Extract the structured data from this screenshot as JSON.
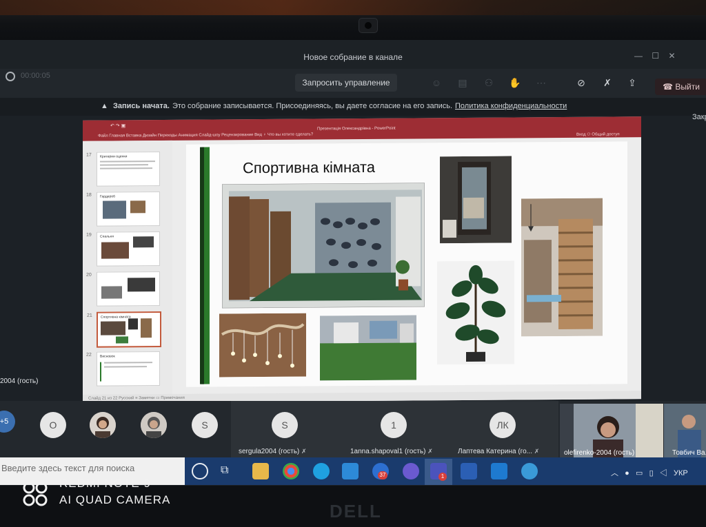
{
  "meeting": {
    "title": "Новое собрание в канале",
    "timer": "00:00:05",
    "request_control_label": "Запросить управление",
    "leave_label": "Выйти",
    "minimize": "—",
    "maximize": "☐",
    "close": "✕"
  },
  "recording_banner": {
    "title": "Запись начата.",
    "message": "Это собрание записывается. Присоединяясь, вы даете согласие на его запись.",
    "link": "Политика конфиденциальности",
    "close_label": "Закрыть"
  },
  "ppt": {
    "window_title": "Презентація Олександрівна - PowerPoint",
    "menus": "Файл   Главная   Вставка   Дизайн   Переходы   Анимация   Слайд-шоу   Рецензирование   Вид   ♀ Что вы хотите сделать?",
    "quick_access": "↶   ↷   ▣",
    "right_tools": "Вход   ⚇ Общий доступ",
    "thumbs": [
      {
        "n": "17",
        "text": "Критерии оценки"
      },
      {
        "n": "18",
        "text": "Гардероб"
      },
      {
        "n": "19",
        "text": "Спальня"
      },
      {
        "n": "20",
        "text": ""
      },
      {
        "n": "21",
        "text": "Спортивна кімната"
      },
      {
        "n": "22",
        "text": "Висновок"
      }
    ],
    "slide_title": "Спортивна кімната",
    "status": "Слайд 21 из 22   Русский   ≡ Заметки   ▭ Примечания"
  },
  "participants": {
    "more_count": "+5",
    "left_guest": "2004 (гость)",
    "avatars": [
      "O",
      "S"
    ],
    "tiles": [
      {
        "initial": "S",
        "name": "sergula2004 (гость)"
      },
      {
        "initial": "1",
        "name": "1anna.shapoval1 (гость)"
      },
      {
        "initial": "ЛК",
        "name": "Лаптева Катерина (го..."
      }
    ],
    "video1_name": "olefirenko-2004 (гость)",
    "video2_name": "Товбич Ва..."
  },
  "taskbar": {
    "search_placeholder": "Введите здесь текст для поиска",
    "lang": "УКР",
    "badge1": "37",
    "badge2": "1"
  },
  "watermark": {
    "line1": "REDMI NOTE 9",
    "line2": "AI QUAD CAMERA"
  },
  "bezel_brand": "DELL",
  "colors": {
    "ppt_accent": "#9d2d34",
    "slide_bar": "#2b7a2b",
    "taskbar": "#1a3b6d"
  }
}
